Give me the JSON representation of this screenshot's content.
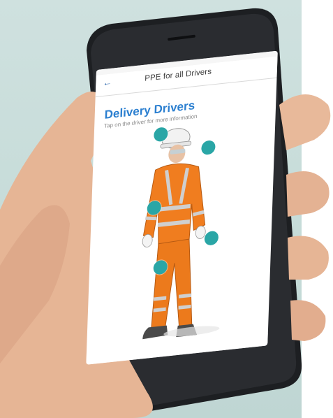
{
  "app": {
    "nav_title": "PPE for all Drivers",
    "back_icon": "back-arrow-icon",
    "back_glyph": "←"
  },
  "content": {
    "title": "Delivery Drivers",
    "subtitle": "Tap on the driver for more information"
  },
  "hotspots": [
    {
      "name": "hotspot-head"
    },
    {
      "name": "hotspot-shoulder"
    },
    {
      "name": "hotspot-torso"
    },
    {
      "name": "hotspot-hand"
    },
    {
      "name": "hotspot-legs"
    }
  ],
  "colors": {
    "accent": "#2b7fd0",
    "hotspot": "#2aa6a6",
    "hi_vis": "#f07d1f",
    "reflective": "#c9c9c9",
    "backdrop": "#c7dcd9",
    "phone_body": "#1d1f22",
    "skin": "#e8b99a"
  }
}
